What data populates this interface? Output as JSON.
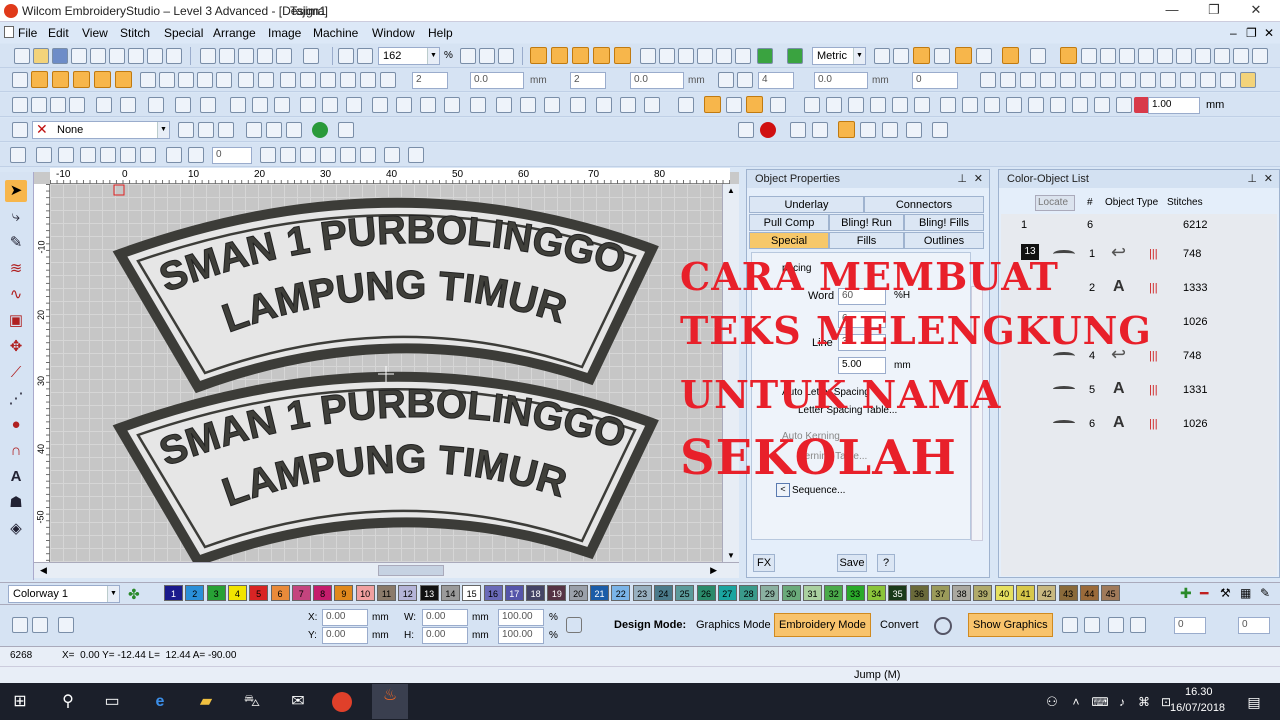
{
  "window": {
    "title": "Wilcom EmbroideryStudio – Level 3 Advanced - [Design1",
    "machine": "Tajima]"
  },
  "menu": [
    "File",
    "Edit",
    "View",
    "Stitch",
    "Special",
    "Arrange",
    "Image",
    "Machine",
    "Window",
    "Help"
  ],
  "toolbar1": {
    "zoom_value": "162",
    "zoom_unit": "%",
    "units": "Metric"
  },
  "toolbar2": {
    "v1": "2",
    "v2": "0.0",
    "unit_mm1": "mm",
    "v3": "2",
    "v4": "0.0",
    "unit_mm2": "mm",
    "v5": "4",
    "v6": "0.0",
    "unit_mm3": "mm",
    "v7": "0"
  },
  "toolbar3": {
    "scale_value": "1.00",
    "scale_unit": "mm"
  },
  "toolbar4": {
    "none_label": "None"
  },
  "toolbar5": {
    "value": "0"
  },
  "ruler": {
    "top": [
      "-10",
      "0",
      "10",
      "20",
      "30",
      "40",
      "50",
      "60",
      "70",
      "80"
    ],
    "left": [
      "-10",
      "20",
      "30",
      "40",
      "-50"
    ]
  },
  "design": {
    "line1": "SMAN 1 PURBOLINGGO",
    "line2": "LAMPUNG TIMUR",
    "stitch_color": "#4a4a44",
    "outline_color": "#2e2e2a"
  },
  "object_properties": {
    "title": "Object Properties",
    "tabs": [
      "Underlay",
      "Connectors",
      "Pull Comp",
      "Bling! Run",
      "Bling! Fills",
      "Special",
      "Fills",
      "Outlines"
    ],
    "spacing_label": "pacing",
    "word_label": "Word",
    "word_value": "60",
    "word_unit": "%H",
    "letter_value": "6",
    "line_label": "Line",
    "line_value": "30",
    "value_500": "5.00",
    "value_unit": "mm",
    "auto_letter": "Auto Letter Spacing",
    "letter_table": "Letter Spacing Table...",
    "auto_kerning": "Auto Kerning",
    "kerning_table": "Kerning Table...",
    "sequence": "Sequence...",
    "fx": "FX",
    "save": "Save",
    "help": "?"
  },
  "color_object_list": {
    "title": "Color-Object List",
    "locate": "Locate",
    "headers": [
      "#",
      "Object Type",
      "Stitches"
    ],
    "summary": {
      "idx": "1",
      "count": "6",
      "stitches": "6212"
    },
    "group_num": "13",
    "rows": [
      {
        "n": "1",
        "stitches": "748"
      },
      {
        "n": "2",
        "stitches": "1333"
      },
      {
        "n": "3",
        "stitches": "1026"
      },
      {
        "n": "4",
        "stitches": "748"
      },
      {
        "n": "5",
        "stitches": "1331"
      },
      {
        "n": "6",
        "stitches": "1026"
      }
    ]
  },
  "overlay_text": {
    "line1": "CARA MEMBUAT",
    "line2": "TEKS MELENGKUNG",
    "line3": "UNTUK NAMA",
    "line4": "SEKOLAH"
  },
  "colorway": {
    "label": "Colorway 1",
    "swatches": [
      {
        "n": "1",
        "c": "#1a1a8c"
      },
      {
        "n": "2",
        "c": "#2a8fd8"
      },
      {
        "n": "3",
        "c": "#27a135"
      },
      {
        "n": "4",
        "c": "#f2e400"
      },
      {
        "n": "5",
        "c": "#d82424"
      },
      {
        "n": "6",
        "c": "#e98a3a"
      },
      {
        "n": "7",
        "c": "#c4447e"
      },
      {
        "n": "8",
        "c": "#c41c6c"
      },
      {
        "n": "9",
        "c": "#e0881c"
      },
      {
        "n": "10",
        "c": "#f1a0a0"
      },
      {
        "n": "11",
        "c": "#8a7a6a"
      },
      {
        "n": "12",
        "c": "#b4b4d8"
      },
      {
        "n": "13",
        "c": "#111111"
      },
      {
        "n": "14",
        "c": "#9a9a9a"
      },
      {
        "n": "15",
        "c": "#ffffff"
      },
      {
        "n": "16",
        "c": "#6a6ab8"
      },
      {
        "n": "17",
        "c": "#5555aa"
      },
      {
        "n": "18",
        "c": "#444466"
      },
      {
        "n": "19",
        "c": "#553344"
      },
      {
        "n": "20",
        "c": "#9aa0aa"
      },
      {
        "n": "21",
        "c": "#1a5ca8"
      },
      {
        "n": "22",
        "c": "#7ab4e8"
      },
      {
        "n": "23",
        "c": "#98b0c0"
      },
      {
        "n": "24",
        "c": "#4a7a8a"
      },
      {
        "n": "25",
        "c": "#5a9a9a"
      },
      {
        "n": "26",
        "c": "#2a8a6a"
      },
      {
        "n": "27",
        "c": "#1aa4a0"
      },
      {
        "n": "28",
        "c": "#3a9a8a"
      },
      {
        "n": "29",
        "c": "#8ab0a0"
      },
      {
        "n": "30",
        "c": "#6aaa7a"
      },
      {
        "n": "31",
        "c": "#aad0a0"
      },
      {
        "n": "32",
        "c": "#4aaa4a"
      },
      {
        "n": "33",
        "c": "#2aaa2a"
      },
      {
        "n": "34",
        "c": "#8ac43a"
      },
      {
        "n": "35",
        "c": "#1a3a1a"
      },
      {
        "n": "36",
        "c": "#6a6a3a"
      },
      {
        "n": "37",
        "c": "#9a9a5a"
      },
      {
        "n": "38",
        "c": "#aaa8a0"
      },
      {
        "n": "39",
        "c": "#b0aa6a"
      },
      {
        "n": "40",
        "c": "#e6e060"
      },
      {
        "n": "41",
        "c": "#d8c84a"
      },
      {
        "n": "42",
        "c": "#c8b880"
      },
      {
        "n": "43",
        "c": "#8a6a3a"
      },
      {
        "n": "44",
        "c": "#9a6a3a"
      },
      {
        "n": "45",
        "c": "#a07a5a"
      }
    ]
  },
  "bottom": {
    "x_label": "X:",
    "x_val": "0.00",
    "y_label": "Y:",
    "y_val": "0.00",
    "mm": "mm",
    "w_label": "W:",
    "w_val": "0.00",
    "h_label": "H:",
    "h_val": "0.00",
    "pct1": "100.00",
    "pct2": "100.00",
    "pct": "%",
    "design_mode_label": "Design Mode:",
    "graphics_mode": "Graphics Mode",
    "embroidery_mode": "Embroidery Mode",
    "convert": "Convert",
    "show_graphics": "Show Graphics",
    "spin1": "0",
    "spin2": "0"
  },
  "status": {
    "stitch_count": "6268",
    "coords": "X=  0.00 Y= -12.44 L=  12.44 A= -90.00",
    "jump": "Jump (M)"
  },
  "taskbar": {
    "time": "16.30",
    "date": "16/07/2018"
  }
}
